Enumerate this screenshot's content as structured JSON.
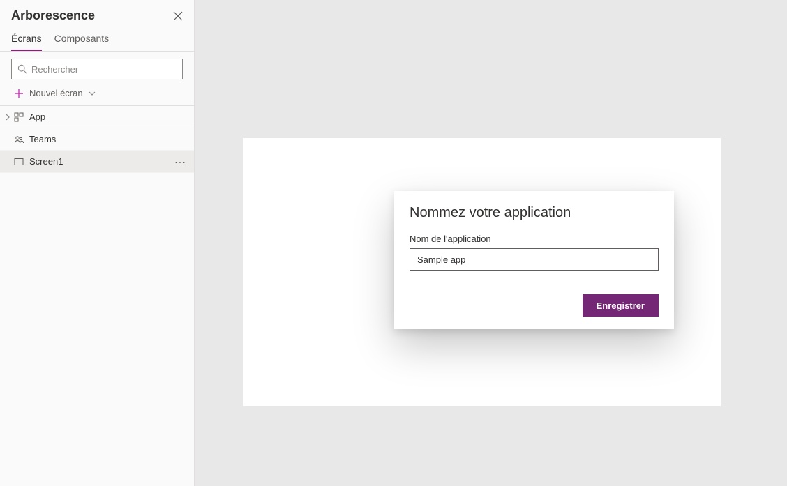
{
  "sidebar": {
    "title": "Arborescence",
    "tabs": {
      "screens": "Écrans",
      "components": "Composants"
    },
    "search_placeholder": "Rechercher",
    "new_screen_label": "Nouvel écran"
  },
  "tree": {
    "items": [
      {
        "label": "App"
      },
      {
        "label": "Teams"
      },
      {
        "label": "Screen1"
      }
    ]
  },
  "dialog": {
    "title": "Nommez votre application",
    "field_label": "Nom de l'application",
    "field_value": "Sample app",
    "save_label": "Enregistrer"
  }
}
